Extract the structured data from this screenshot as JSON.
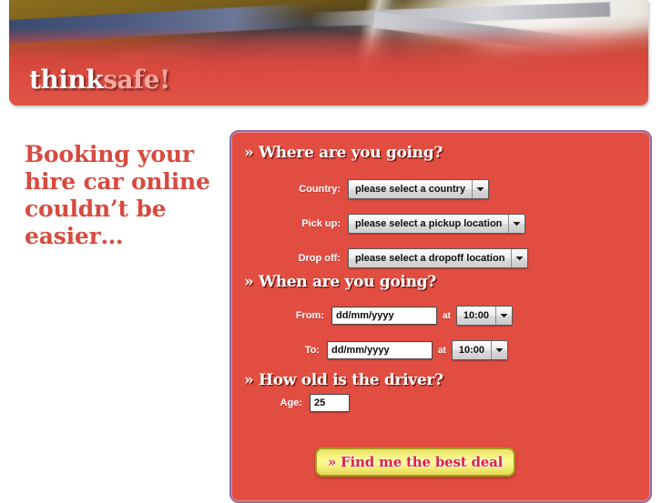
{
  "header": {
    "logo_think": "think",
    "logo_safe": "safe!",
    "banner_icon": "road-photo-banner"
  },
  "promo": {
    "heading": "Booking your hire car online couldn’t be easier…"
  },
  "panel": {
    "sections": {
      "where": "» Where are you going?",
      "when": "» When are you going?",
      "age": "» How old is the driver?"
    },
    "fields": {
      "country": {
        "label": "Country:",
        "value": "please select a country"
      },
      "pickup": {
        "label": "Pick up:",
        "value": "please select a pickup location"
      },
      "dropoff": {
        "label": "Drop off:",
        "value": "please select a dropoff location"
      },
      "from": {
        "label": "From:",
        "value": "dd/mm/yyyy",
        "at": "at",
        "time": "10:00"
      },
      "to": {
        "label": "To:",
        "value": "dd/mm/yyyy",
        "at": "at",
        "time": "10:00"
      },
      "age": {
        "label": "Age:",
        "value": "25"
      }
    },
    "submit_label": "» Find me the best deal"
  },
  "colors": {
    "panel_red": "#e24d41",
    "panel_border_purple": "#8b6fae",
    "promo_red": "#d84a3f",
    "button_yellow": "#f7f37c",
    "button_text_red": "#e01f3d",
    "logo_pink": "#f7a9a1"
  }
}
